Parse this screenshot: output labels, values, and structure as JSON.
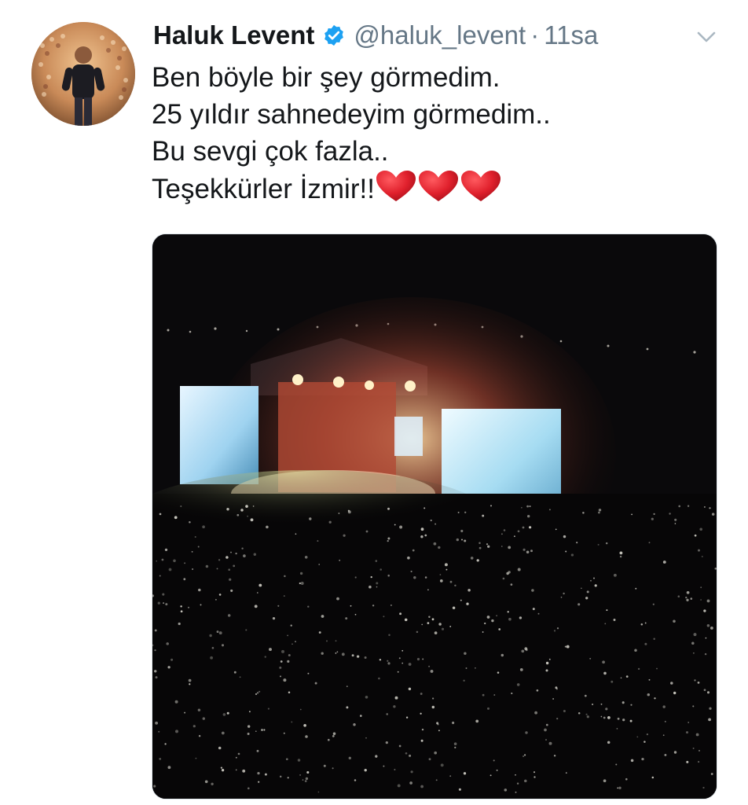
{
  "tweet": {
    "author_name": "Haluk Levent",
    "handle": "@haluk_levent",
    "separator": "·",
    "time": "11sa",
    "lines": [
      "Ben böyle bir şey görmedim.",
      "25 yıldır sahnedeyim görmedim..",
      "Bu sevgi çok fazla..",
      "Teşekkürler İzmir!!"
    ],
    "heart_count": 3
  },
  "icons": {
    "verified": "verified-badge-icon",
    "menu": "chevron-down-icon",
    "heart": "red-heart-emoji"
  },
  "colors": {
    "text_primary": "#14171a",
    "text_secondary": "#657786",
    "verified_blue": "#1da1f2",
    "heart_red": "#e0202c"
  }
}
